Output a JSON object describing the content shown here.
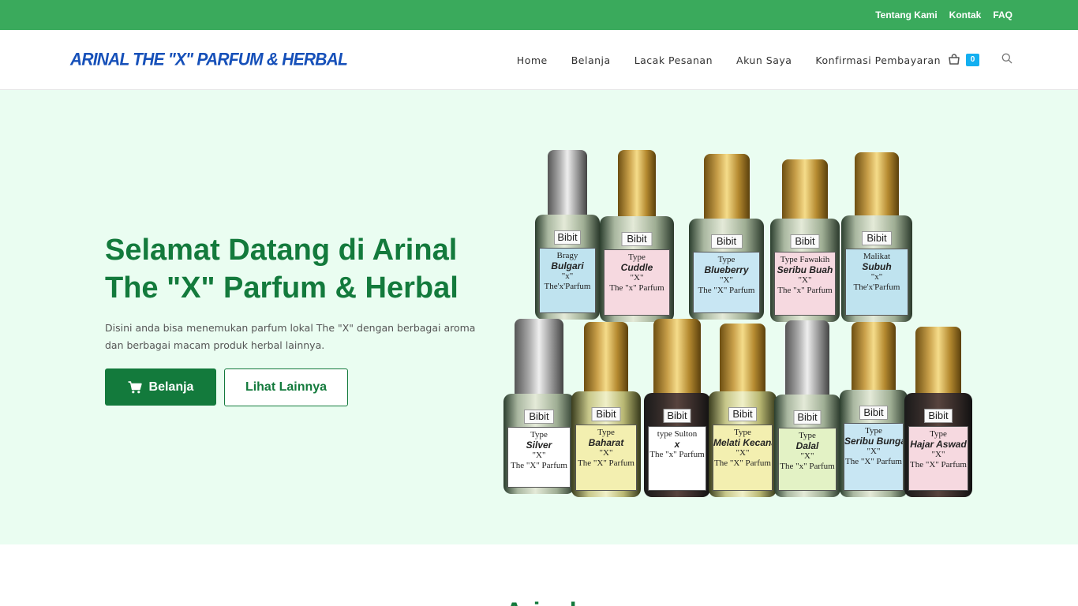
{
  "topbar": {
    "links": [
      "Tentang Kami",
      "Kontak",
      "FAQ"
    ]
  },
  "header": {
    "logo": "ARINAL THE \"X\" PARFUM & HERBAL",
    "nav": [
      "Home",
      "Belanja",
      "Lacak Pesanan",
      "Akun Saya",
      "Konfirmasi Pembayaran"
    ],
    "cart_count": "0"
  },
  "hero": {
    "title_line1": "Selamat Datang di Arinal",
    "title_line2": "The \"X\" Parfum & Herbal",
    "text_line1": "Disini anda bisa menemukan parfum lokal The \"X\" dengan berbagai aroma",
    "text_line2": "dan berbagai macam produk herbal lainnya.",
    "btn_primary": "Belanja",
    "btn_secondary": "Lihat Lainnya"
  },
  "bottles": {
    "top_row": [
      {
        "brand": "Bibit",
        "l1": "Bragy",
        "l2": "Bulgari",
        "l3": "\"x\"",
        "l4": "The'x'Parfum",
        "cap": "silver",
        "label_color": "#bfe3ef"
      },
      {
        "brand": "Bibit",
        "l1": "Type",
        "l2": "Cuddle",
        "l3": "\"X\"",
        "l4": "The \"x\" Parfum",
        "cap": "gold",
        "label_color": "#f6d9e0"
      },
      {
        "brand": "Bibit",
        "l1": "Type",
        "l2": "Blueberry",
        "l3": "\"X\"",
        "l4": "The \"X\" Parfum",
        "cap": "gold",
        "label_color": "#c8e6f3"
      },
      {
        "brand": "Bibit",
        "l1": "Type Fawakih",
        "l2": "Seribu Buah",
        "l3": "\"X\"",
        "l4": "The \"x\" Parfum",
        "cap": "gold",
        "label_color": "#f6d9e0"
      },
      {
        "brand": "Bibit",
        "l1": "Malikat",
        "l2": "Subuh",
        "l3": "\"x\"",
        "l4": "The'x'Parfum",
        "cap": "gold",
        "label_color": "#bfe3ef"
      }
    ],
    "bottom_row": [
      {
        "brand": "Bibit",
        "l1": "Type",
        "l2": "Silver",
        "l3": "\"X\"",
        "l4": "The \"X\" Parfum",
        "cap": "silver",
        "label_color": "#ffffff"
      },
      {
        "brand": "Bibit",
        "l1": "Type",
        "l2": "Baharat",
        "l3": "\"X\"",
        "l4": "The \"X\" Parfum",
        "cap": "gold",
        "label_color": "#f3efb0"
      },
      {
        "brand": "Bibit",
        "l1": "type Sulton",
        "l2": "x",
        "l3": "",
        "l4": "The \"x\" Parfum",
        "cap": "gold",
        "label_color": "#ffffff"
      },
      {
        "brand": "Bibit",
        "l1": "Type",
        "l2": "Melati Kecana",
        "l3": "\"X\"",
        "l4": "The \"X\" Parfum",
        "cap": "gold",
        "label_color": "#f3efb0"
      },
      {
        "brand": "Bibit",
        "l1": "Type",
        "l2": "Dalal",
        "l3": "\"X\"",
        "l4": "The \"x\" Parfum",
        "cap": "silver",
        "label_color": "#e3f2c5"
      },
      {
        "brand": "Bibit",
        "l1": "Type",
        "l2": "Seribu Bunga",
        "l3": "\"X\"",
        "l4": "The \"X\" Parfum",
        "cap": "gold",
        "label_color": "#c8e6f3"
      },
      {
        "brand": "Bibit",
        "l1": "Type",
        "l2": "Hajar Aswad",
        "l3": "\"X\"",
        "l4": "The \"X\" Parfum",
        "cap": "gold",
        "label_color": "#f6d9e0"
      }
    ]
  },
  "colors": {
    "topbar": "#3aaa5c",
    "primary_green": "#137a3c",
    "logo_blue": "#1650b9",
    "hero_bg": "#eafdf1",
    "cart_badge": "#13aff0"
  }
}
